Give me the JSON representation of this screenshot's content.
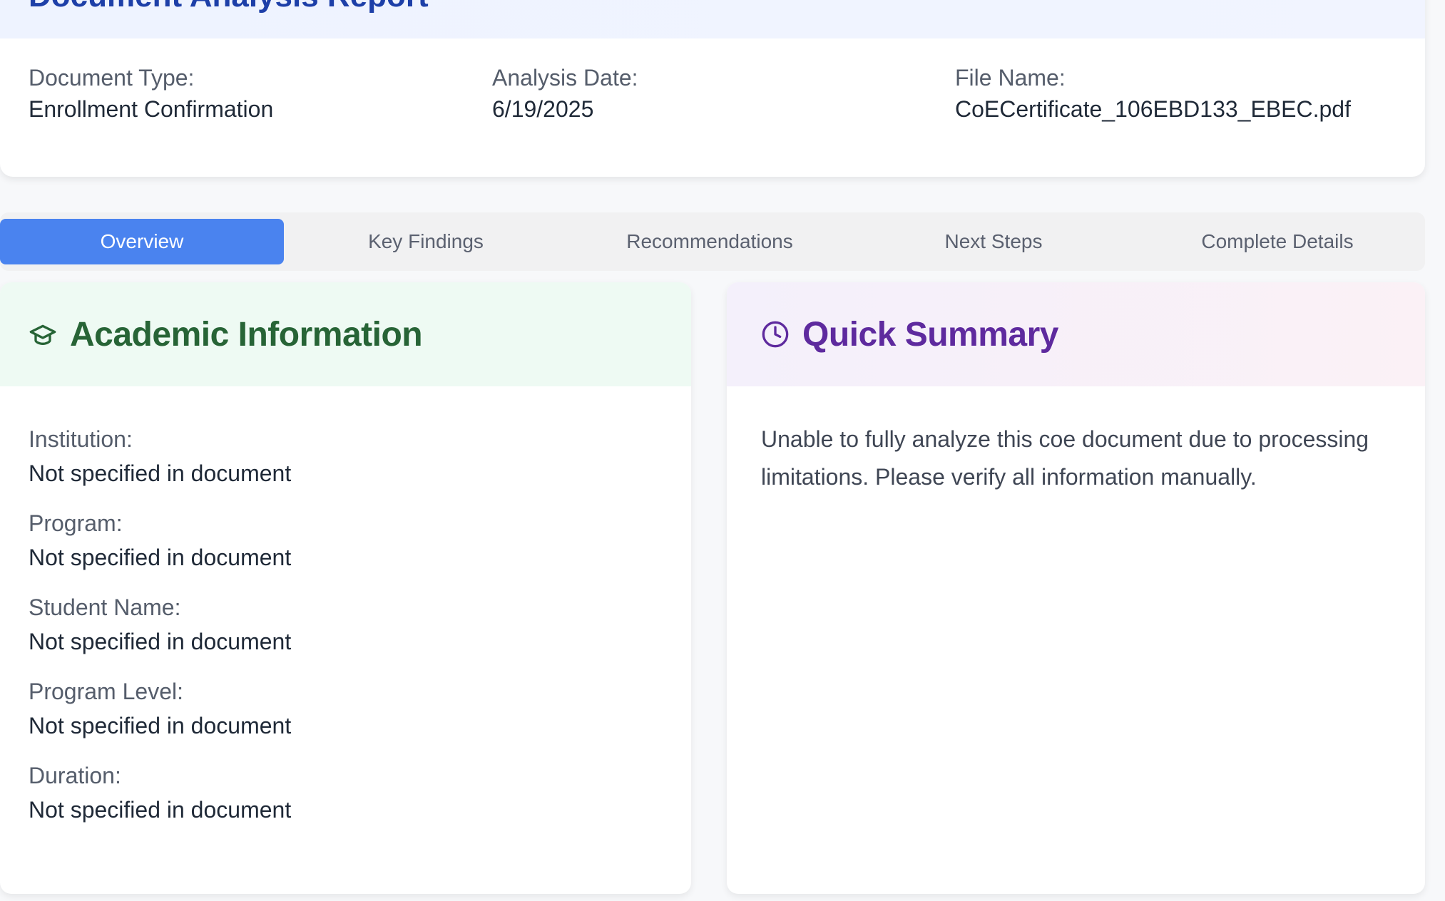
{
  "header": {
    "title": "Document Analysis Report",
    "fields": [
      {
        "label": "Document Type:",
        "value": "Enrollment Confirmation"
      },
      {
        "label": "Analysis Date:",
        "value": "6/19/2025"
      },
      {
        "label": "File Name:",
        "value": "CoECertificate_106EBD133_EBEC.pdf"
      }
    ]
  },
  "tabs": [
    {
      "label": "Overview",
      "active": true
    },
    {
      "label": "Key Findings",
      "active": false
    },
    {
      "label": "Recommendations",
      "active": false
    },
    {
      "label": "Next Steps",
      "active": false
    },
    {
      "label": "Complete Details",
      "active": false
    }
  ],
  "academic": {
    "title": "Academic Information",
    "icon": "graduation-cap-icon",
    "fields": [
      {
        "label": "Institution:",
        "value": "Not specified in document"
      },
      {
        "label": "Program:",
        "value": "Not specified in document"
      },
      {
        "label": "Student Name:",
        "value": "Not specified in document"
      },
      {
        "label": "Program Level:",
        "value": "Not specified in document"
      },
      {
        "label": "Duration:",
        "value": "Not specified in document"
      }
    ]
  },
  "summary": {
    "title": "Quick Summary",
    "icon": "clock-icon",
    "text": "Unable to fully analyze this coe document due to processing limitations. Please verify all information manually."
  },
  "colors": {
    "accent_blue": "#4a83ef",
    "academic_green": "#276436",
    "summary_purple": "#5e2a9e",
    "title_blue": "#1d3fa8"
  }
}
